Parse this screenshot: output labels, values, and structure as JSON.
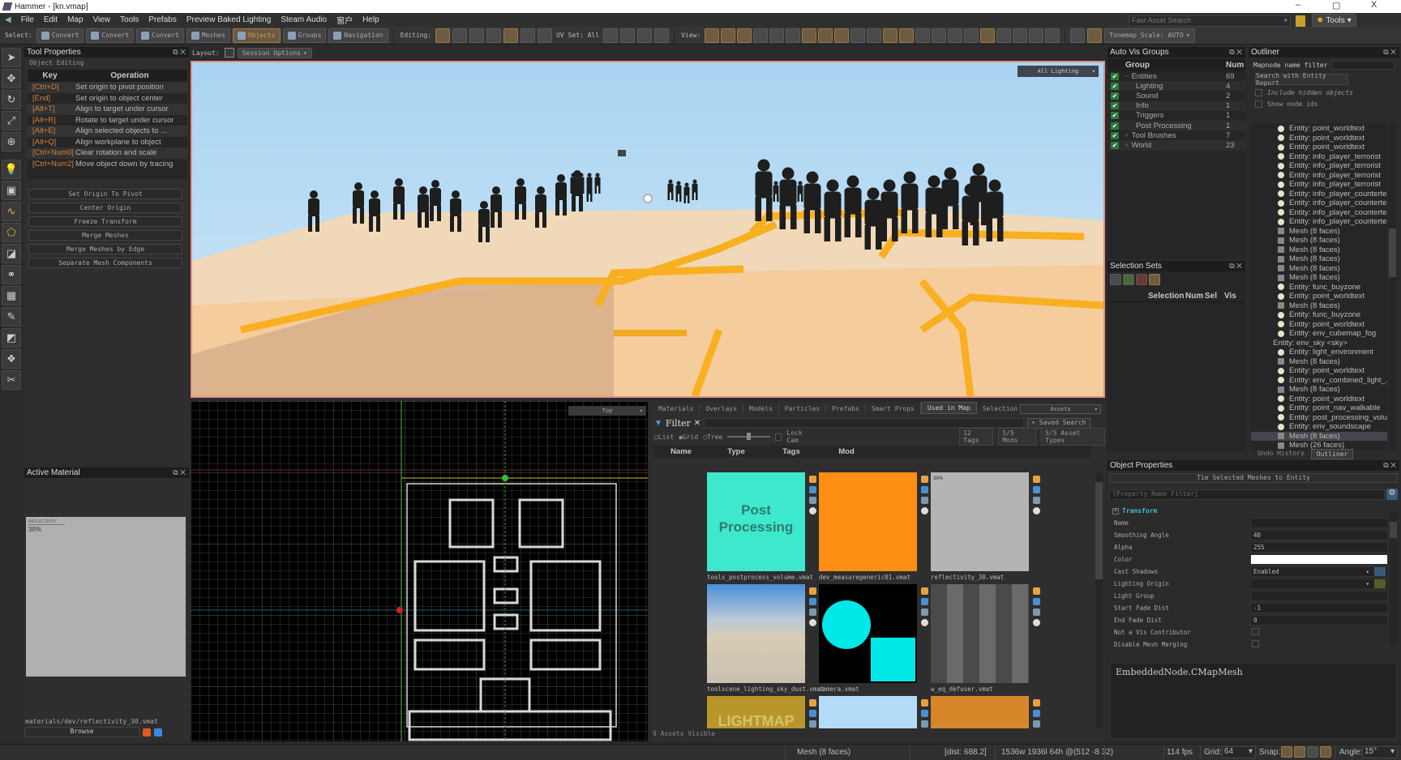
{
  "window": {
    "title": "Hammer - [kn.vmap]",
    "minimize": "–",
    "maximize": "▢",
    "close": "X"
  },
  "menu": [
    "File",
    "Edit",
    "Map",
    "View",
    "Tools",
    "Prefabs",
    "Preview Baked Lighting",
    "Steam Audio",
    "窗户",
    "Help"
  ],
  "toolbar": {
    "select_label": "Select:",
    "select_modes": [
      {
        "label": "Convert",
        "icon": "vertex-icon"
      },
      {
        "label": "Convert",
        "icon": "edge-icon"
      },
      {
        "label": "Convert",
        "icon": "face-icon"
      },
      {
        "label": "Meshes",
        "icon": "mesh-icon"
      },
      {
        "label": "Objects",
        "icon": "object-icon",
        "active": true
      },
      {
        "label": "Groups",
        "icon": "groups-icon"
      },
      {
        "label": "Navigation",
        "icon": "navigation-icon"
      }
    ],
    "editing_label": "Editing:",
    "uv_set": "UV Set: All",
    "view_label": "View:",
    "tonemap": "Tonemap Scale: AUTO",
    "fast_asset_search_placeholder": "Fast Asset Search",
    "tools_label": "Tools"
  },
  "tool_properties": {
    "title": "Tool Properties",
    "section": "Object Editing",
    "headers": [
      "Key",
      "Operation"
    ],
    "rows": [
      {
        "key": "[Ctrl+D]",
        "op": "Set origin to pivot position"
      },
      {
        "key": "[End]",
        "op": "Set origin to object center"
      },
      {
        "key": "[Alt+T]",
        "op": "Align to target under cursor"
      },
      {
        "key": "[Alt+R]",
        "op": "Rotate to target under cursor"
      },
      {
        "key": "[Alt+E]",
        "op": "Align selected objects to ..."
      },
      {
        "key": "[Alt+Q]",
        "op": "Align workplane to object"
      },
      {
        "key": "[Ctrl+Num0]",
        "op": "Clear rotation and scale"
      },
      {
        "key": "[Ctrl+Num2]",
        "op": "Move object down by tracing"
      }
    ],
    "buttons": [
      "Set Origin To Pivot",
      "Center Origin",
      "Freeze Transform",
      "Merge Meshes",
      "Merge Meshes by Edge",
      "Separate Mesh Components"
    ]
  },
  "active_material": {
    "title": "Active Material",
    "preview_label": "REFLECTIVITY",
    "preview_value": "30%",
    "path": "materials/dev/reflectivity_30.vmat",
    "browse": "Browse"
  },
  "layout": {
    "label": "Layout:",
    "session_options": "Session Options"
  },
  "viewport3d": {
    "render_mode": "All Lighting"
  },
  "viewport2d": {
    "view": "Top"
  },
  "asset_browser": {
    "tabs": [
      "Materials",
      "Overlays",
      "Models",
      "Particles",
      "Prefabs",
      "Smart Props",
      "Used in Map",
      "Selection"
    ],
    "active_tab": "Used in Map",
    "assets_dropdown": "Assets",
    "filter_label": "Filter",
    "saved_search": "Saved Search",
    "view_modes": [
      "List",
      "Grid",
      "Tree"
    ],
    "selected_view": "Grid",
    "lock_cam": "Lock Cam",
    "tags": "12 Tags",
    "mods": "5/5 Mods",
    "asset_types": "5/5 Asset Types",
    "columns": [
      "Name",
      "Type",
      "Tags",
      "Mod"
    ],
    "items": [
      {
        "name": "tools_postprocess_volume.vmat",
        "thumb_text": "Post Processing",
        "color": "#3ee8cc"
      },
      {
        "name": "dev_measuregeneric01.vmat",
        "color": "#ff8e14"
      },
      {
        "name": "reflectivity_30.vmat",
        "thumb_text": "30%",
        "color": "#b4b4b4"
      },
      {
        "name": "toolscene_lighting_sky_dust.vmat",
        "color": "#c7c2b6"
      },
      {
        "name": "camera.vmat",
        "color": "#00f0f0"
      },
      {
        "name": "w_eq_defuser.vmat",
        "color": "#5a5a5a"
      },
      {
        "name": "",
        "thumb_text": "LIGHTMAP",
        "color": "#b8962a"
      },
      {
        "name": "",
        "color": "#b4dcf8"
      },
      {
        "name": "",
        "color": "#d8862a"
      }
    ],
    "status": "9 Assets Visible"
  },
  "auto_vis_groups": {
    "title": "Auto Vis Groups",
    "headers": [
      "Group",
      "Num"
    ],
    "rows": [
      {
        "name": "Entities",
        "num": "69",
        "level": 0,
        "expand": "−"
      },
      {
        "name": "Lighting",
        "num": "4",
        "level": 1
      },
      {
        "name": "Sound",
        "num": "2",
        "level": 1
      },
      {
        "name": "Info",
        "num": "1",
        "level": 1
      },
      {
        "name": "Triggers",
        "num": "1",
        "level": 1
      },
      {
        "name": "Post Processing",
        "num": "1",
        "level": 1
      },
      {
        "name": "Tool Brushes",
        "num": "7",
        "level": 0,
        "expand": "+"
      },
      {
        "name": "World",
        "num": "23",
        "level": 0,
        "expand": "+"
      }
    ]
  },
  "selection_sets": {
    "title": "Selection Sets",
    "headers": [
      "Selection",
      "Num",
      "Sel",
      "Vis"
    ]
  },
  "outliner": {
    "title": "Outliner",
    "filter_label": "Mapnode name filter",
    "search_button": "Search with Entity Report",
    "include_hidden": "Include hidden objects",
    "show_node_ids": "Show node ids",
    "items": [
      "Entity: point_worldtext",
      "Entity: point_worldtext",
      "Entity: point_worldtext",
      "Entity: info_player_terrorist",
      "Entity: info_player_terrorist",
      "Entity: info_player_terrorist",
      "Entity: info_player_terrorist",
      "Entity: info_player_counterte...",
      "Entity: info_player_counterte...",
      "Entity: info_player_counterte...",
      "Entity: info_player_counterte...",
      "Mesh (8 faces)",
      "Mesh (8 faces)",
      "Mesh (8 faces)",
      "Mesh (8 faces)",
      "Mesh (8 faces)",
      "Mesh (8 faces)",
      "Entity: func_buyzone",
      "Entity: point_worldtext",
      "Mesh (8 faces)",
      "Entity: func_buyzone",
      "Entity: point_worldtext",
      "Entity: env_cubemap_fog",
      "Entity: env_sky <sky>",
      "Entity: light_environment",
      "Mesh (8 faces)",
      "Entity: point_worldtext",
      "Entity: env_combined_light_...",
      "Mesh (8 faces)",
      "Entity: point_worldtext",
      "Entity: point_nav_walkable",
      "Entity: post_processing_volu...",
      "Entity: env_soundscape",
      "Mesh (8 faces)",
      "Mesh (26 faces)"
    ],
    "selected_index": 33,
    "tabs": [
      "Undo History",
      "Outliner"
    ],
    "active_tab": "Outliner"
  },
  "object_properties": {
    "title": "Object Properties",
    "tie_button": "Tie Selected Meshes to Entity",
    "filter_placeholder": "[Property Name Filter]",
    "section": "Transform",
    "rows": [
      {
        "key": "Name",
        "value": ""
      },
      {
        "key": "Smoothing Angle",
        "value": "40"
      },
      {
        "key": "Alpha",
        "value": "255"
      },
      {
        "key": "Color",
        "value": "",
        "color": "#ffffff"
      },
      {
        "key": "Cast Shadows",
        "value": "Enabled"
      },
      {
        "key": "Lighting Origin",
        "value": ""
      },
      {
        "key": "Light Group",
        "value": ""
      },
      {
        "key": "Start Fade Dist",
        "value": "-1"
      },
      {
        "key": "End Fade Dist",
        "value": "0"
      },
      {
        "key": "Not a Vis Contributor",
        "checkbox": false
      },
      {
        "key": "Disable Mesh Merging",
        "checkbox": false
      }
    ],
    "description": "EmbeddedNode.CMapMesh"
  },
  "status_bar": {
    "selection": "Mesh (8 faces)",
    "dist": "[dist: 688.2]",
    "dims": "1536w 1936l 64h @(512 -8 32)",
    "fps": "114 fps",
    "grid_label": "Grid:",
    "grid": "64",
    "snap_label": "Snap:",
    "angle_label": "Angle:",
    "angle": "15°"
  }
}
